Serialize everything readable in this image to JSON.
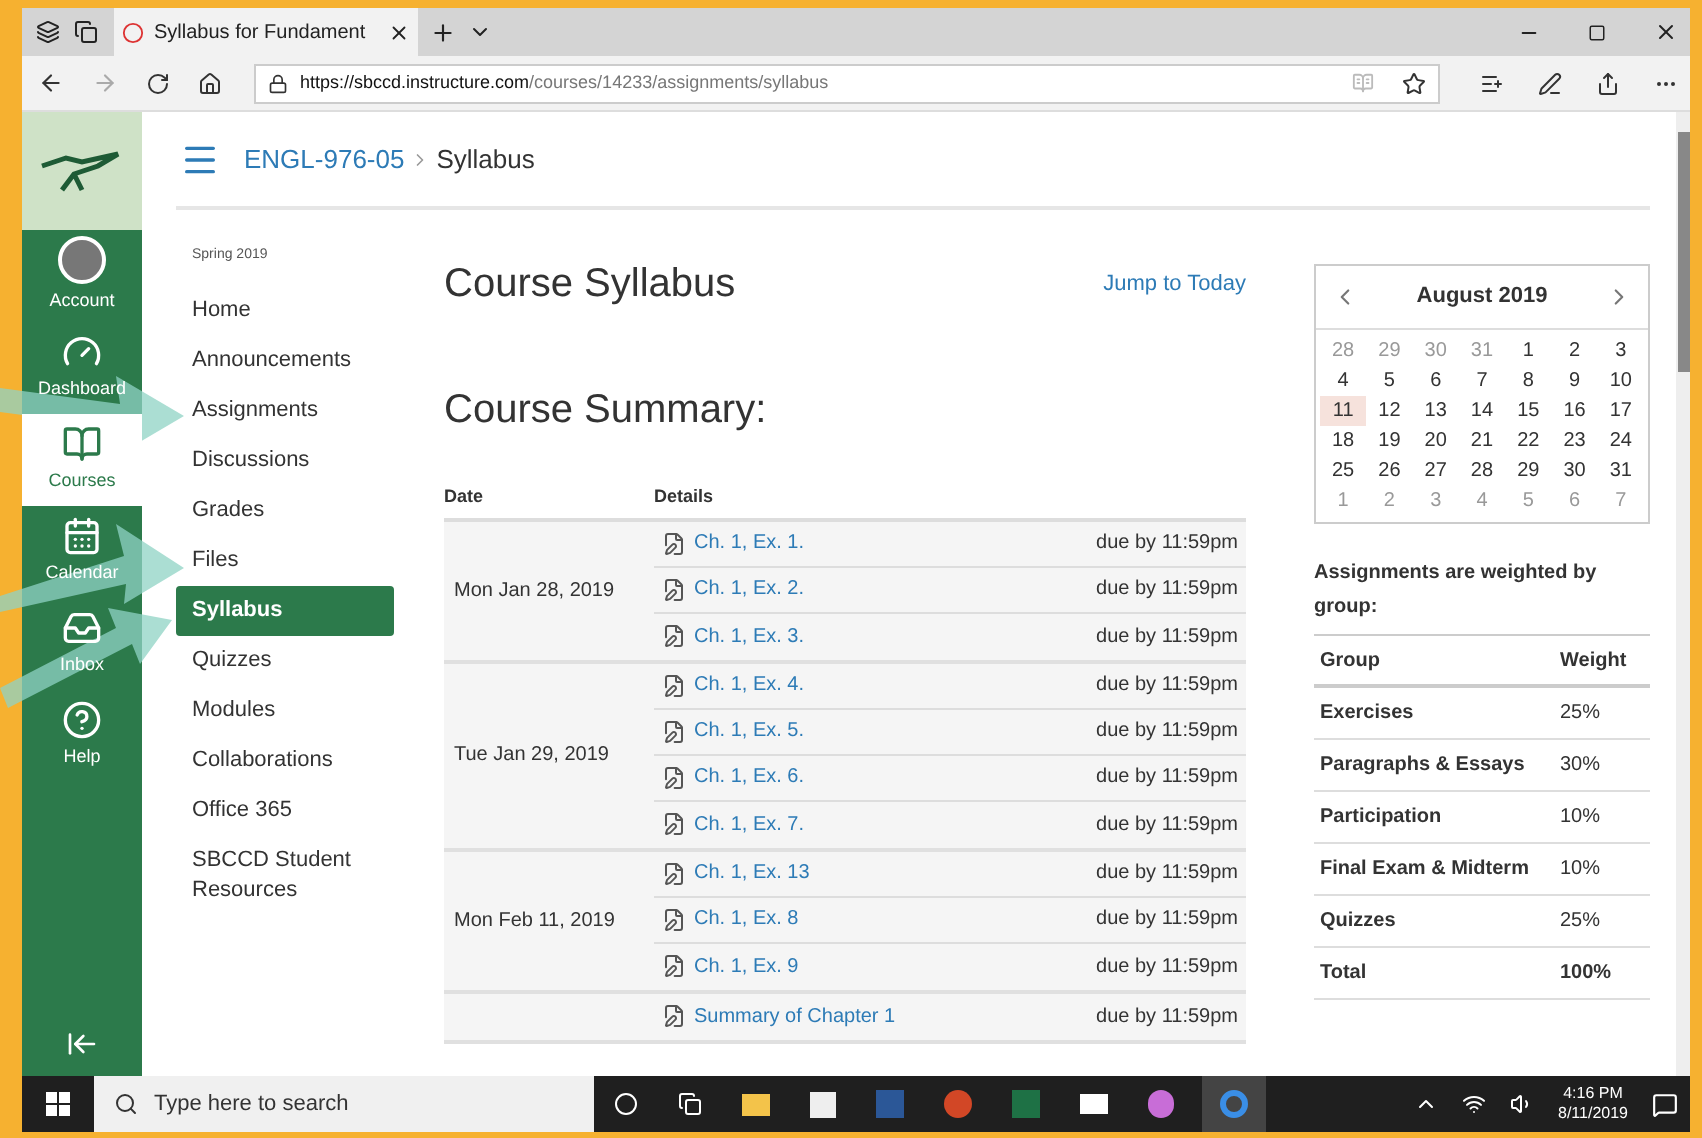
{
  "browser": {
    "tab_title": "Syllabus for Fundament",
    "url_host": "https://sbccd.instructure.com",
    "url_path": "/courses/14233/assignments/syllabus"
  },
  "global_nav": [
    {
      "kind": "account",
      "label": "Account",
      "selected": false
    },
    {
      "kind": "dashboard",
      "label": "Dashboard",
      "selected": false
    },
    {
      "kind": "courses",
      "label": "Courses",
      "selected": true
    },
    {
      "kind": "calendar",
      "label": "Calendar",
      "selected": false
    },
    {
      "kind": "inbox",
      "label": "Inbox",
      "selected": false
    },
    {
      "kind": "help",
      "label": "Help",
      "selected": false
    }
  ],
  "breadcrumb": {
    "course": "ENGL-976-05",
    "page": "Syllabus"
  },
  "course_nav": {
    "term": "Spring 2019",
    "items": [
      {
        "label": "Home",
        "selected": false
      },
      {
        "label": "Announcements",
        "selected": false
      },
      {
        "label": "Assignments",
        "selected": false
      },
      {
        "label": "Discussions",
        "selected": false
      },
      {
        "label": "Grades",
        "selected": false
      },
      {
        "label": "Files",
        "selected": false
      },
      {
        "label": "Syllabus",
        "selected": true
      },
      {
        "label": "Quizzes",
        "selected": false
      },
      {
        "label": "Modules",
        "selected": false
      },
      {
        "label": "Collaborations",
        "selected": false
      },
      {
        "label": "Office 365",
        "selected": false
      },
      {
        "label": "SBCCD Student Resources",
        "selected": false
      }
    ]
  },
  "main": {
    "title": "Course Syllabus",
    "jump_link": "Jump to Today",
    "summary_title": "Course Summary:",
    "columns": [
      "Date",
      "Details"
    ],
    "groups": [
      {
        "date": "Mon Jan 28, 2019",
        "items": [
          {
            "title": "Ch. 1, Ex. 1.",
            "due": "due by 11:59pm"
          },
          {
            "title": "Ch. 1, Ex. 2.",
            "due": "due by 11:59pm"
          },
          {
            "title": "Ch. 1, Ex. 3.",
            "due": "due by 11:59pm"
          }
        ]
      },
      {
        "date": "Tue Jan 29, 2019",
        "items": [
          {
            "title": "Ch. 1, Ex. 4.",
            "due": "due by 11:59pm"
          },
          {
            "title": "Ch. 1, Ex. 5.",
            "due": "due by 11:59pm"
          },
          {
            "title": "Ch. 1, Ex. 6.",
            "due": "due by 11:59pm"
          },
          {
            "title": "Ch. 1, Ex. 7.",
            "due": "due by 11:59pm"
          }
        ]
      },
      {
        "date": "Mon Feb 11, 2019",
        "items": [
          {
            "title": "Ch. 1, Ex. 13",
            "due": "due by 11:59pm"
          },
          {
            "title": "Ch. 1, Ex. 8",
            "due": "due by 11:59pm"
          },
          {
            "title": "Ch. 1, Ex. 9",
            "due": "due by 11:59pm"
          }
        ]
      },
      {
        "items": [
          {
            "title": "Summary of Chapter 1",
            "due": "due by 11:59pm"
          }
        ]
      }
    ]
  },
  "calendar": {
    "month": "August 2019",
    "weeks": [
      [
        {
          "day": "28",
          "outside": true,
          "today": false
        },
        {
          "day": "29",
          "outside": true,
          "today": false
        },
        {
          "day": "30",
          "outside": true,
          "today": false
        },
        {
          "day": "31",
          "outside": true,
          "today": false
        },
        {
          "day": "1",
          "outside": false,
          "today": false
        },
        {
          "day": "2",
          "outside": false,
          "today": false
        },
        {
          "day": "3",
          "outside": false,
          "today": false
        }
      ],
      [
        {
          "day": "4",
          "outside": false,
          "today": false
        },
        {
          "day": "5",
          "outside": false,
          "today": false
        },
        {
          "day": "6",
          "outside": false,
          "today": false
        },
        {
          "day": "7",
          "outside": false,
          "today": false
        },
        {
          "day": "8",
          "outside": false,
          "today": false
        },
        {
          "day": "9",
          "outside": false,
          "today": false
        },
        {
          "day": "10",
          "outside": false,
          "today": false
        }
      ],
      [
        {
          "day": "11",
          "outside": false,
          "today": true
        },
        {
          "day": "12",
          "outside": false,
          "today": false
        },
        {
          "day": "13",
          "outside": false,
          "today": false
        },
        {
          "day": "14",
          "outside": false,
          "today": false
        },
        {
          "day": "15",
          "outside": false,
          "today": false
        },
        {
          "day": "16",
          "outside": false,
          "today": false
        },
        {
          "day": "17",
          "outside": false,
          "today": false
        }
      ],
      [
        {
          "day": "18",
          "outside": false,
          "today": false
        },
        {
          "day": "19",
          "outside": false,
          "today": false
        },
        {
          "day": "20",
          "outside": false,
          "today": false
        },
        {
          "day": "21",
          "outside": false,
          "today": false
        },
        {
          "day": "22",
          "outside": false,
          "today": false
        },
        {
          "day": "23",
          "outside": false,
          "today": false
        },
        {
          "day": "24",
          "outside": false,
          "today": false
        }
      ],
      [
        {
          "day": "25",
          "outside": false,
          "today": false
        },
        {
          "day": "26",
          "outside": false,
          "today": false
        },
        {
          "day": "27",
          "outside": false,
          "today": false
        },
        {
          "day": "28",
          "outside": false,
          "today": false
        },
        {
          "day": "29",
          "outside": false,
          "today": false
        },
        {
          "day": "30",
          "outside": false,
          "today": false
        },
        {
          "day": "31",
          "outside": false,
          "today": false
        }
      ],
      [
        {
          "day": "1",
          "outside": true,
          "today": false
        },
        {
          "day": "2",
          "outside": true,
          "today": false
        },
        {
          "day": "3",
          "outside": true,
          "today": false
        },
        {
          "day": "4",
          "outside": true,
          "today": false
        },
        {
          "day": "5",
          "outside": true,
          "today": false
        },
        {
          "day": "6",
          "outside": true,
          "today": false
        },
        {
          "day": "7",
          "outside": true,
          "today": false
        }
      ]
    ]
  },
  "weights": {
    "intro": "Assignments are weighted by group:",
    "columns": [
      "Group",
      "Weight"
    ],
    "rows": [
      {
        "group": "Exercises",
        "weight": "25%",
        "total": false
      },
      {
        "group": "Paragraphs & Essays",
        "weight": "30%",
        "total": false
      },
      {
        "group": "Participation",
        "weight": "10%",
        "total": false
      },
      {
        "group": "Final Exam & Midterm",
        "weight": "10%",
        "total": false
      },
      {
        "group": "Quizzes",
        "weight": "25%",
        "total": false
      },
      {
        "group": "Total",
        "weight": "100%",
        "total": true
      }
    ]
  },
  "taskbar": {
    "search_placeholder": "Type here to search",
    "time": "4:16 PM",
    "date": "8/11/2019"
  }
}
